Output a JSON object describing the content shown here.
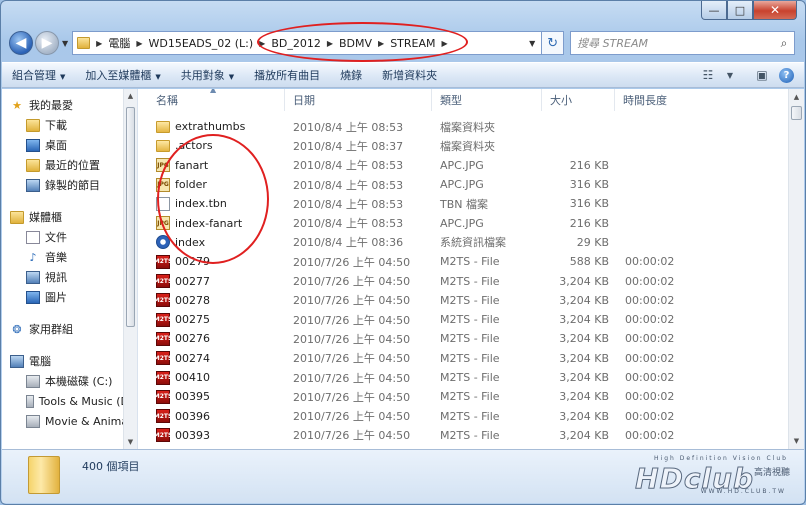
{
  "window": {
    "caption_min": "—",
    "caption_max": "□",
    "caption_close": "✕"
  },
  "address": {
    "back_glyph": "◀",
    "fwd_glyph": "▶",
    "crumbs": [
      "電腦",
      "WD15EADS_02 (L:)",
      "BD_2012",
      "BDMV",
      "STREAM"
    ],
    "refresh_glyph": "↻",
    "search_placeholder": "搜尋 STREAM"
  },
  "toolbar": {
    "organize": "組合管理",
    "add_to_library": "加入至媒體櫃",
    "share_with": "共用對象",
    "play_all": "播放所有曲目",
    "burn": "燒錄",
    "new_folder": "新增資料夾",
    "help": "?"
  },
  "sidebar": {
    "favorites": {
      "label": "我的最愛",
      "items": [
        "下載",
        "桌面",
        "最近的位置",
        "錄製的節目"
      ]
    },
    "libraries": {
      "label": "媒體櫃",
      "items": [
        "文件",
        "音樂",
        "視訊",
        "圖片"
      ]
    },
    "homegroup": "家用群組",
    "computer": {
      "label": "電腦",
      "items": [
        "本機磁碟 (C:)",
        "Tools & Music (D:)",
        "Movie & Anima"
      ]
    }
  },
  "columns": {
    "name": "名稱",
    "date": "日期",
    "type": "類型",
    "size": "大小",
    "duration": "時間長度"
  },
  "files": [
    {
      "icon": "folder-icon",
      "name": "extrathumbs",
      "date": "2010/8/4 上午 08:53",
      "type": "檔案資料夾",
      "size": "",
      "duration": ""
    },
    {
      "icon": "folder-icon",
      "name": ".actors",
      "date": "2010/8/4 上午 08:37",
      "type": "檔案資料夾",
      "size": "",
      "duration": ""
    },
    {
      "icon": "jpg-file-icon",
      "name": "fanart",
      "date": "2010/8/4 上午 08:53",
      "type": "APC.JPG",
      "size": "216 KB",
      "duration": ""
    },
    {
      "icon": "jpg-file-icon",
      "name": "folder",
      "date": "2010/8/4 上午 08:53",
      "type": "APC.JPG",
      "size": "316 KB",
      "duration": ""
    },
    {
      "icon": "document-file-icon",
      "name": "index.tbn",
      "date": "2010/8/4 上午 08:53",
      "type": "TBN 檔案",
      "size": "316 KB",
      "duration": ""
    },
    {
      "icon": "jpg-file-icon",
      "name": "index-fanart",
      "date": "2010/8/4 上午 08:53",
      "type": "APC.JPG",
      "size": "216 KB",
      "duration": ""
    },
    {
      "icon": "system-info-file-icon",
      "name": "index",
      "date": "2010/8/4 上午 08:36",
      "type": "系統資訊檔案",
      "size": "29 KB",
      "duration": ""
    },
    {
      "icon": "m2ts-file-icon",
      "name": "00279",
      "date": "2010/7/26 上午 04:50",
      "type": "M2TS - File",
      "size": "588 KB",
      "duration": "00:00:02"
    },
    {
      "icon": "m2ts-file-icon",
      "name": "00277",
      "date": "2010/7/26 上午 04:50",
      "type": "M2TS - File",
      "size": "3,204 KB",
      "duration": "00:00:02"
    },
    {
      "icon": "m2ts-file-icon",
      "name": "00278",
      "date": "2010/7/26 上午 04:50",
      "type": "M2TS - File",
      "size": "3,204 KB",
      "duration": "00:00:02"
    },
    {
      "icon": "m2ts-file-icon",
      "name": "00275",
      "date": "2010/7/26 上午 04:50",
      "type": "M2TS - File",
      "size": "3,204 KB",
      "duration": "00:00:02"
    },
    {
      "icon": "m2ts-file-icon",
      "name": "00276",
      "date": "2010/7/26 上午 04:50",
      "type": "M2TS - File",
      "size": "3,204 KB",
      "duration": "00:00:02"
    },
    {
      "icon": "m2ts-file-icon",
      "name": "00274",
      "date": "2010/7/26 上午 04:50",
      "type": "M2TS - File",
      "size": "3,204 KB",
      "duration": "00:00:02"
    },
    {
      "icon": "m2ts-file-icon",
      "name": "00410",
      "date": "2010/7/26 上午 04:50",
      "type": "M2TS - File",
      "size": "3,204 KB",
      "duration": "00:00:02"
    },
    {
      "icon": "m2ts-file-icon",
      "name": "00395",
      "date": "2010/7/26 上午 04:50",
      "type": "M2TS - File",
      "size": "3,204 KB",
      "duration": "00:00:02"
    },
    {
      "icon": "m2ts-file-icon",
      "name": "00396",
      "date": "2010/7/26 上午 04:50",
      "type": "M2TS - File",
      "size": "3,204 KB",
      "duration": "00:00:02"
    },
    {
      "icon": "m2ts-file-icon",
      "name": "00393",
      "date": "2010/7/26 上午 04:50",
      "type": "M2TS - File",
      "size": "3,204 KB",
      "duration": "00:00:02"
    }
  ],
  "status": {
    "item_count": "400 個項目"
  },
  "watermark": {
    "tagline": "High Definition Vision Club",
    "logo": "HDclub",
    "chinese": "高清視聽",
    "url": "WWW.HD.CLUB.TW"
  },
  "colors": {
    "annotation": "#e02020",
    "window_frame": "#a9c8ea"
  }
}
